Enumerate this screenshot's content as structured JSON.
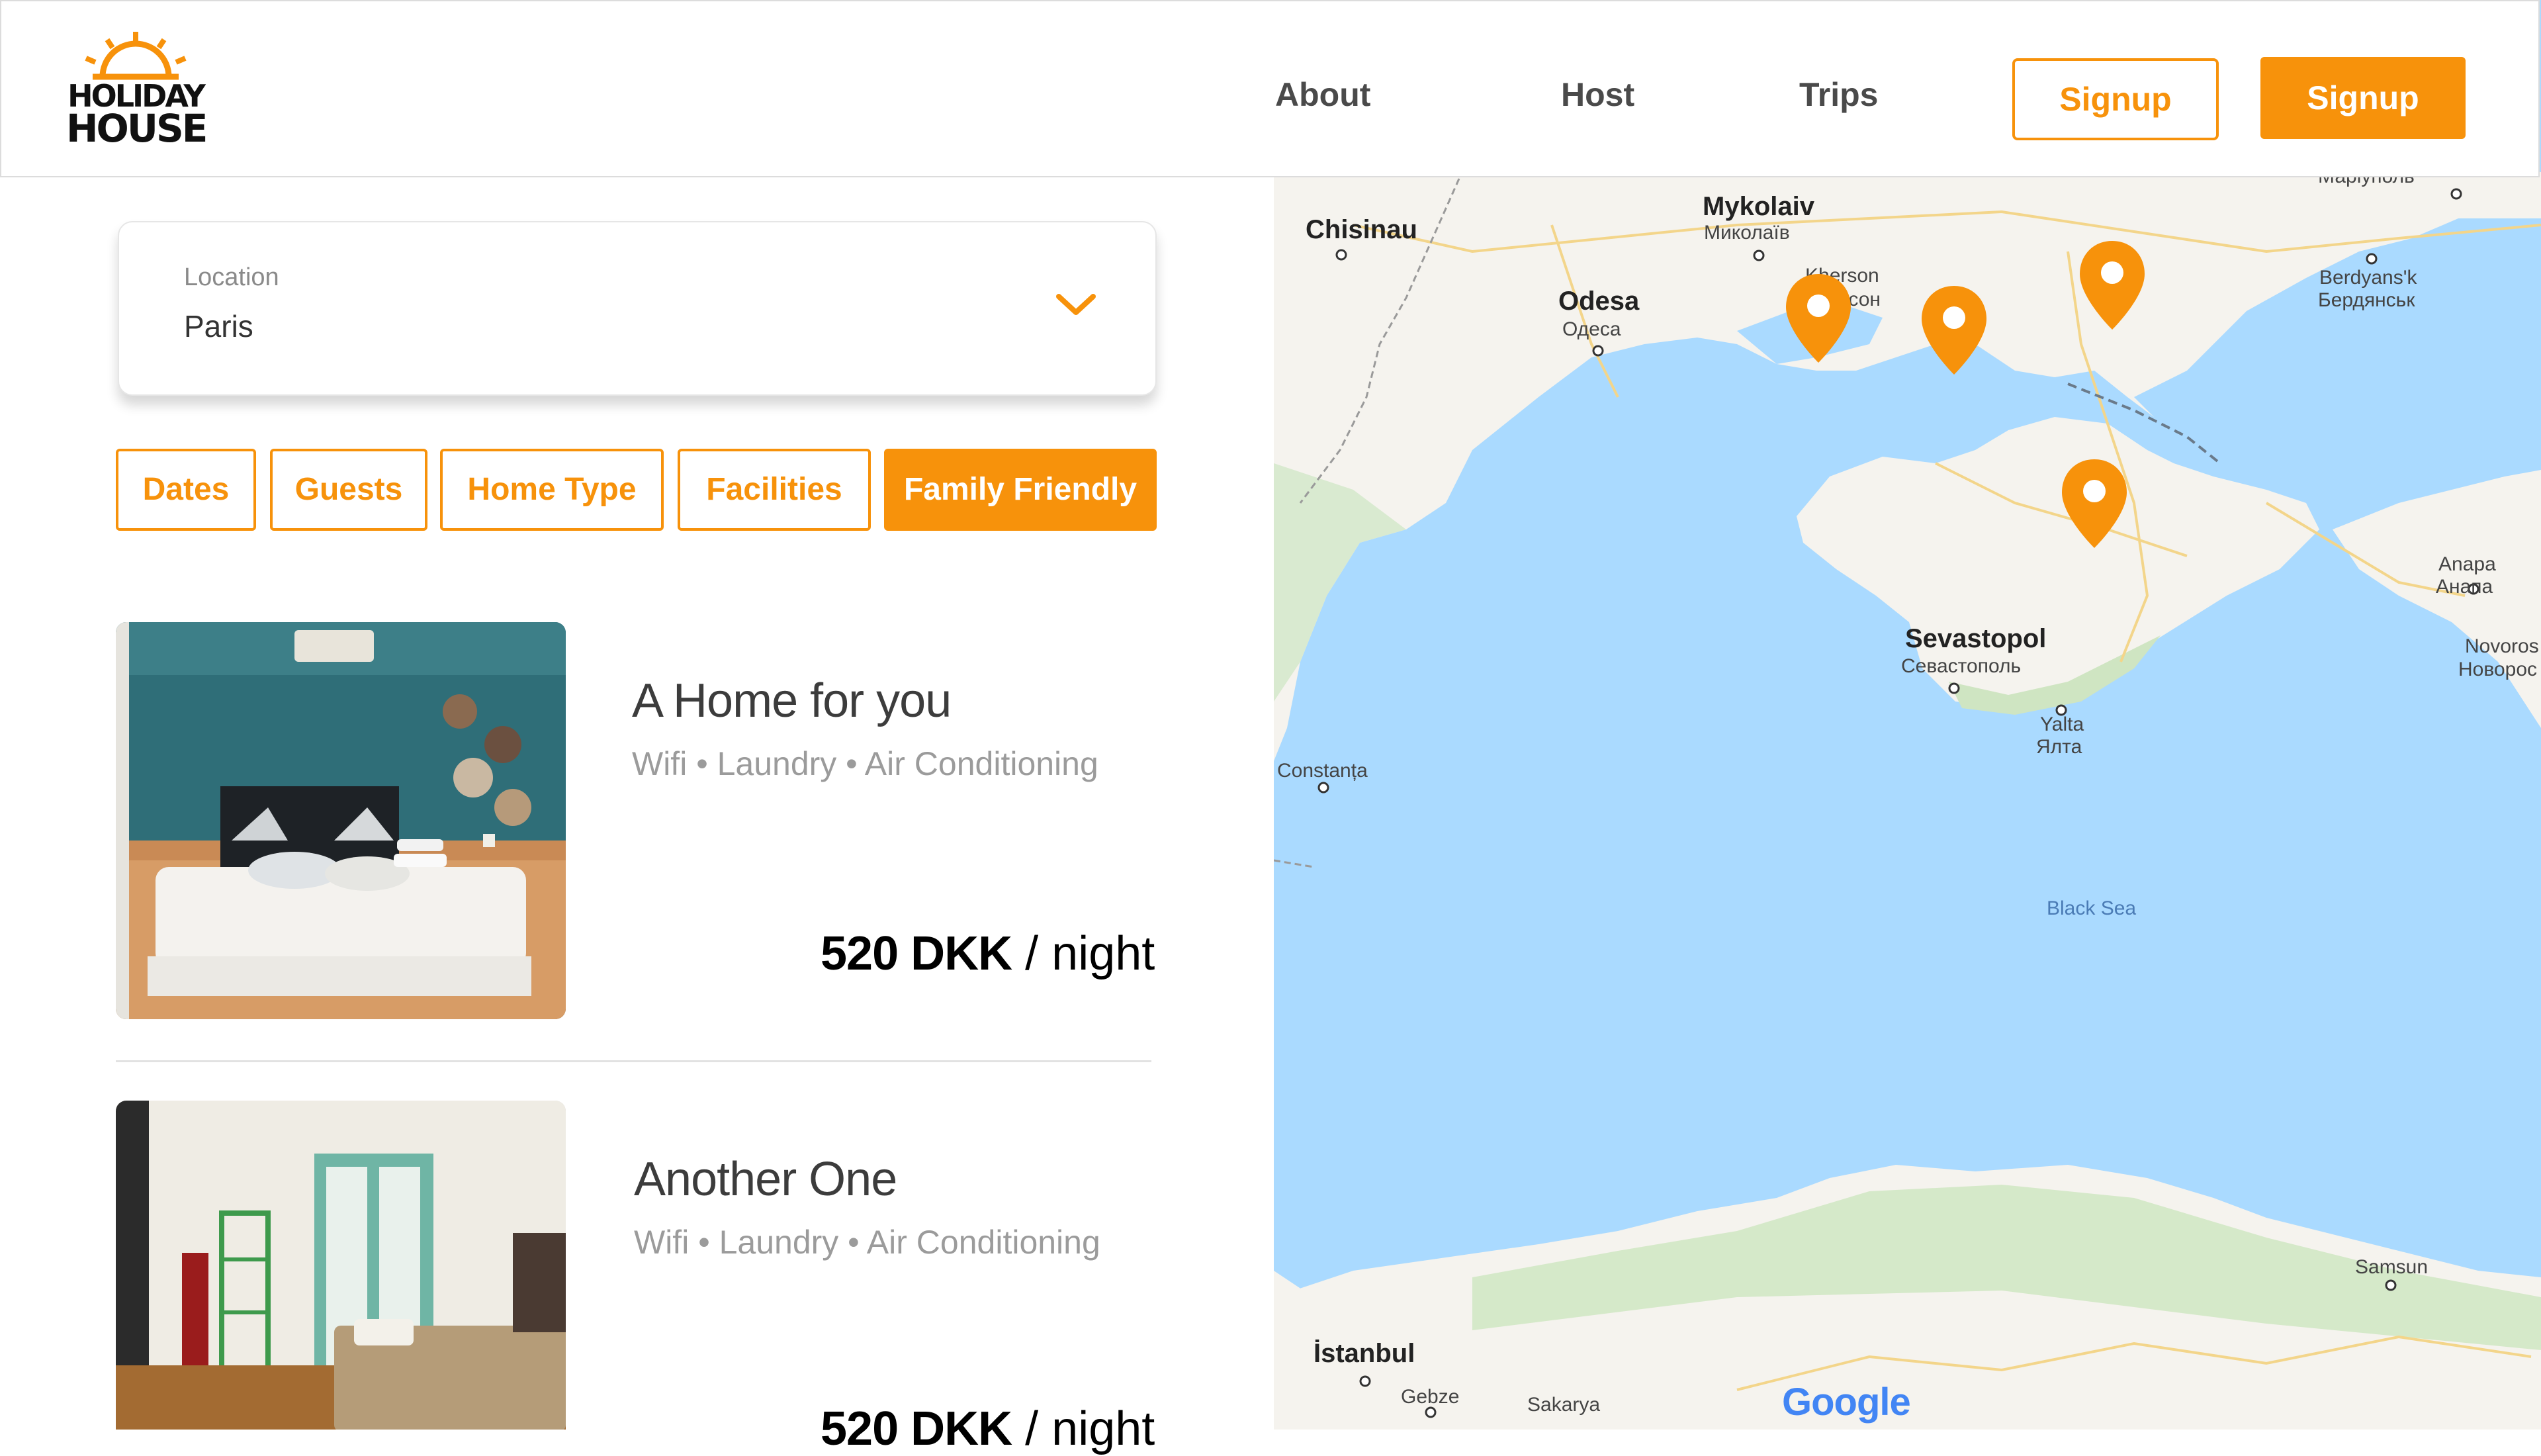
{
  "brand": {
    "line1": "HOLIDAY",
    "line2": "HOUSE",
    "accent_color": "#f7920b"
  },
  "nav": {
    "about": "About",
    "host": "Host",
    "trips": "Trips",
    "signup_outline": "Signup",
    "signup_primary": "Signup"
  },
  "search": {
    "location_label": "Location",
    "location_value": "Paris",
    "chevron_icon": "chevron-down-icon"
  },
  "filters": [
    {
      "label": "Dates",
      "active": false
    },
    {
      "label": "Guests",
      "active": false
    },
    {
      "label": "Home Type",
      "active": false
    },
    {
      "label": "Facilities",
      "active": false
    },
    {
      "label": "Family Friendly",
      "active": true
    }
  ],
  "listings": [
    {
      "title": "A Home for you",
      "facilities": "Wifi • Laundry • Air Conditioning",
      "price": "520 DKK",
      "unit": "/ night"
    },
    {
      "title": "Another One",
      "facilities": "Wifi • Laundry • Air Conditioning",
      "price": "520 DKK",
      "unit": "/ night"
    }
  ],
  "map": {
    "labels": {
      "chisinau": "Chisinau",
      "mykolaiv": "Mykolaiv",
      "mykolaiv_cyr": "Миколаїв",
      "kherson": "Kherson",
      "kherson_cyr": "Херсон",
      "odesa": "Odesa",
      "odesa_cyr": "Одеса",
      "berdyansk": "Berdyans'k",
      "berdyansk_cyr": "Бердянськ",
      "mariupol_cyr": "Маріуполь",
      "anapa": "Anapa",
      "anapa_cyr": "Анапа",
      "novoros": "Novoros",
      "novoros_cyr": "Новорос",
      "sevastopol": "Sevastopol",
      "sevastopol_cyr": "Севастополь",
      "yalta": "Yalta",
      "yalta_cyr": "Ялта",
      "constanta": "Constanța",
      "black_sea": "Black Sea",
      "samsun": "Samsun",
      "istanbul": "İstanbul",
      "gebze": "Gebze",
      "sakarya": "Sakarya"
    },
    "attribution": "Google",
    "water_color": "#aadaff",
    "land_color": "#f5f3ee",
    "pin_icon": "map-pin-icon"
  }
}
